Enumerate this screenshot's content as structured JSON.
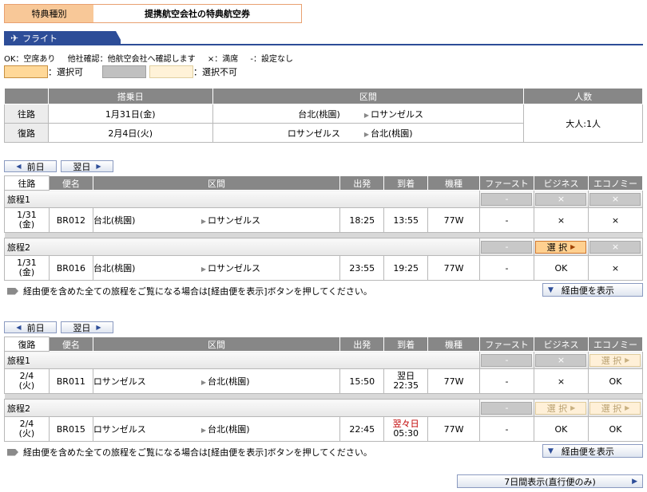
{
  "award": {
    "label": "特典種別",
    "value": "提携航空会社の特典航空券"
  },
  "flight_tab": "フライト",
  "legend": {
    "items": [
      "OK：空席あり",
      "他社確認：他航空会社へ確認します",
      "×：満席",
      "-：設定なし"
    ],
    "available": "：選択可",
    "unavailable": "：選択不可"
  },
  "summary": {
    "headers": [
      "搭乗日",
      "区間",
      "人数"
    ],
    "rows": [
      {
        "dir": "往路",
        "date": "1月31日(金)",
        "from": "台北(桃園)",
        "to": "ロサンゼルス"
      },
      {
        "dir": "復路",
        "date": "2月4日(火)",
        "from": "ロサンゼルス",
        "to": "台北(桃園)"
      }
    ],
    "pax": "大人:1人"
  },
  "nav": {
    "prev": "前日",
    "next": "翌日"
  },
  "grid_headers": [
    "便名",
    "区間",
    "出発",
    "到着",
    "機種",
    "ファースト",
    "ビジネス",
    "エコノミー"
  ],
  "outbound": {
    "dir": "往路",
    "itineraries": [
      {
        "label": "旅程1",
        "btn_first": "-",
        "btn_business": "×",
        "btn_economy": "×",
        "date1": "1/31",
        "date2": "(金)",
        "flight": "BR012",
        "from": "台北(桃園)",
        "to": "ロサンゼルス",
        "dep": "18:25",
        "arr": "13:55",
        "aircraft": "77W",
        "first": "-",
        "business": "×",
        "economy": "×"
      },
      {
        "label": "旅程2",
        "btn_first": "-",
        "btn_business": "選 択",
        "btn_economy": "×",
        "date1": "1/31",
        "date2": "(金)",
        "flight": "BR016",
        "from": "台北(桃園)",
        "to": "ロサンゼルス",
        "dep": "23:55",
        "arr": "19:25",
        "aircraft": "77W",
        "first": "-",
        "business": "OK",
        "economy": "×"
      }
    ]
  },
  "inbound": {
    "dir": "復路",
    "itineraries": [
      {
        "label": "旅程1",
        "btn_first": "-",
        "btn_business": "×",
        "btn_economy": "選 択",
        "date1": "2/4",
        "date2": "(火)",
        "flight": "BR011",
        "from": "ロサンゼルス",
        "to": "台北(桃園)",
        "dep": "15:50",
        "arr_note": "翌日",
        "arr": "22:35",
        "aircraft": "77W",
        "first": "-",
        "business": "×",
        "economy": "OK"
      },
      {
        "label": "旅程2",
        "btn_first": "-",
        "btn_business": "選 択",
        "btn_economy": "選 択",
        "date1": "2/4",
        "date2": "(火)",
        "flight": "BR015",
        "from": "ロサンゼルス",
        "to": "台北(桃園)",
        "dep": "22:45",
        "arr_note": "翌々日",
        "arr": "05:30",
        "aircraft": "77W",
        "first": "-",
        "business": "OK",
        "economy": "OK"
      }
    ]
  },
  "note": "経由便を含めた全ての旅程をご覧になる場合は[経由便を表示]ボタンを押してください。",
  "via_button": "経由便を表示",
  "seven_day_button": "7日間表示(直行便のみ)"
}
